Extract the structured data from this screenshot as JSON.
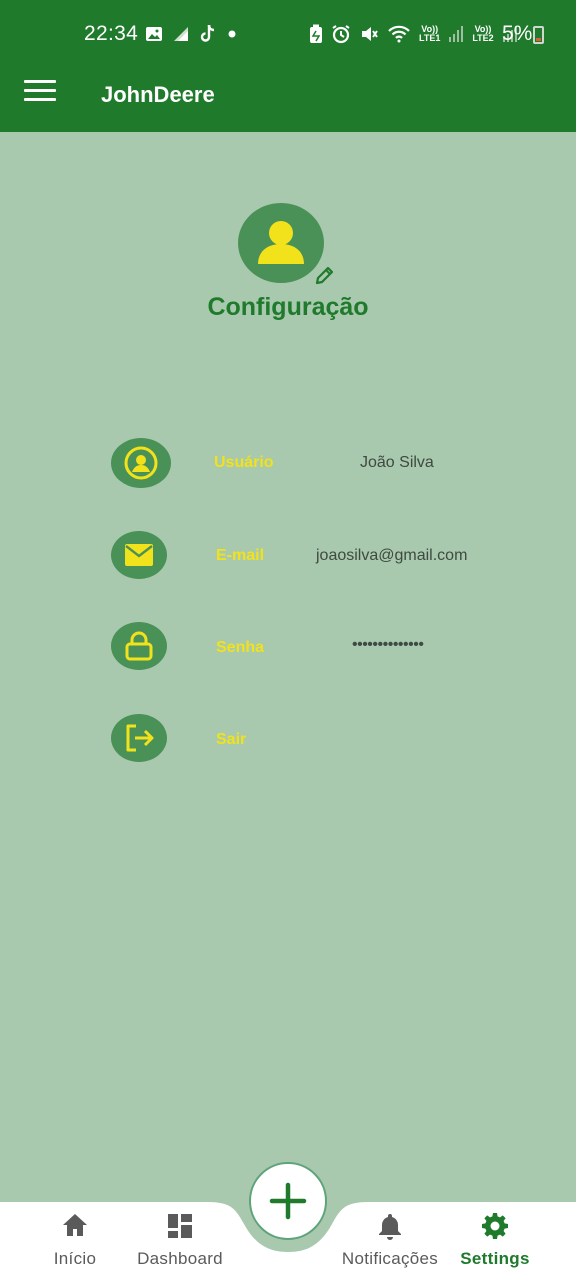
{
  "status_bar": {
    "time": "22:34",
    "battery": "5%",
    "sim1": "LTE1",
    "sim2": "LTE2",
    "volte": "Vo))",
    "icons": [
      "image-icon",
      "signal-icon",
      "tiktok-icon",
      "dot-icon",
      "battery-saver-icon",
      "alarm-icon",
      "mute-icon",
      "wifi-icon",
      "lte1-icon",
      "lte2-icon",
      "battery-icon"
    ]
  },
  "app_bar": {
    "title": "JohnDeere",
    "menu_icon": "menu-icon"
  },
  "profile": {
    "title": "Configuração",
    "avatar_icon": "user-avatar-icon",
    "edit_icon": "pencil-icon"
  },
  "settings": [
    {
      "icon": "user-circle-icon",
      "label": "Usuário",
      "value": "João Silva"
    },
    {
      "icon": "mail-icon",
      "label": "E-mail",
      "value": "joaosilva@gmail.com"
    },
    {
      "icon": "lock-icon",
      "label": "Senha",
      "value": "••••••••••••••"
    },
    {
      "icon": "logout-icon",
      "label": "Sair",
      "value": ""
    }
  ],
  "bottom_nav": {
    "items": [
      {
        "icon": "home-icon",
        "label": "Início"
      },
      {
        "icon": "dashboard-icon",
        "label": "Dashboard"
      },
      {
        "icon": "bell-icon",
        "label": "Notificações"
      },
      {
        "icon": "gear-icon",
        "label": "Settings"
      }
    ],
    "active": "Settings",
    "fab_icon": "plus-icon"
  },
  "colors": {
    "primary": "#1f7a2c",
    "background": "#a8c9ae",
    "icon_circle": "#4a9157",
    "accent_yellow": "#f2e21b"
  }
}
